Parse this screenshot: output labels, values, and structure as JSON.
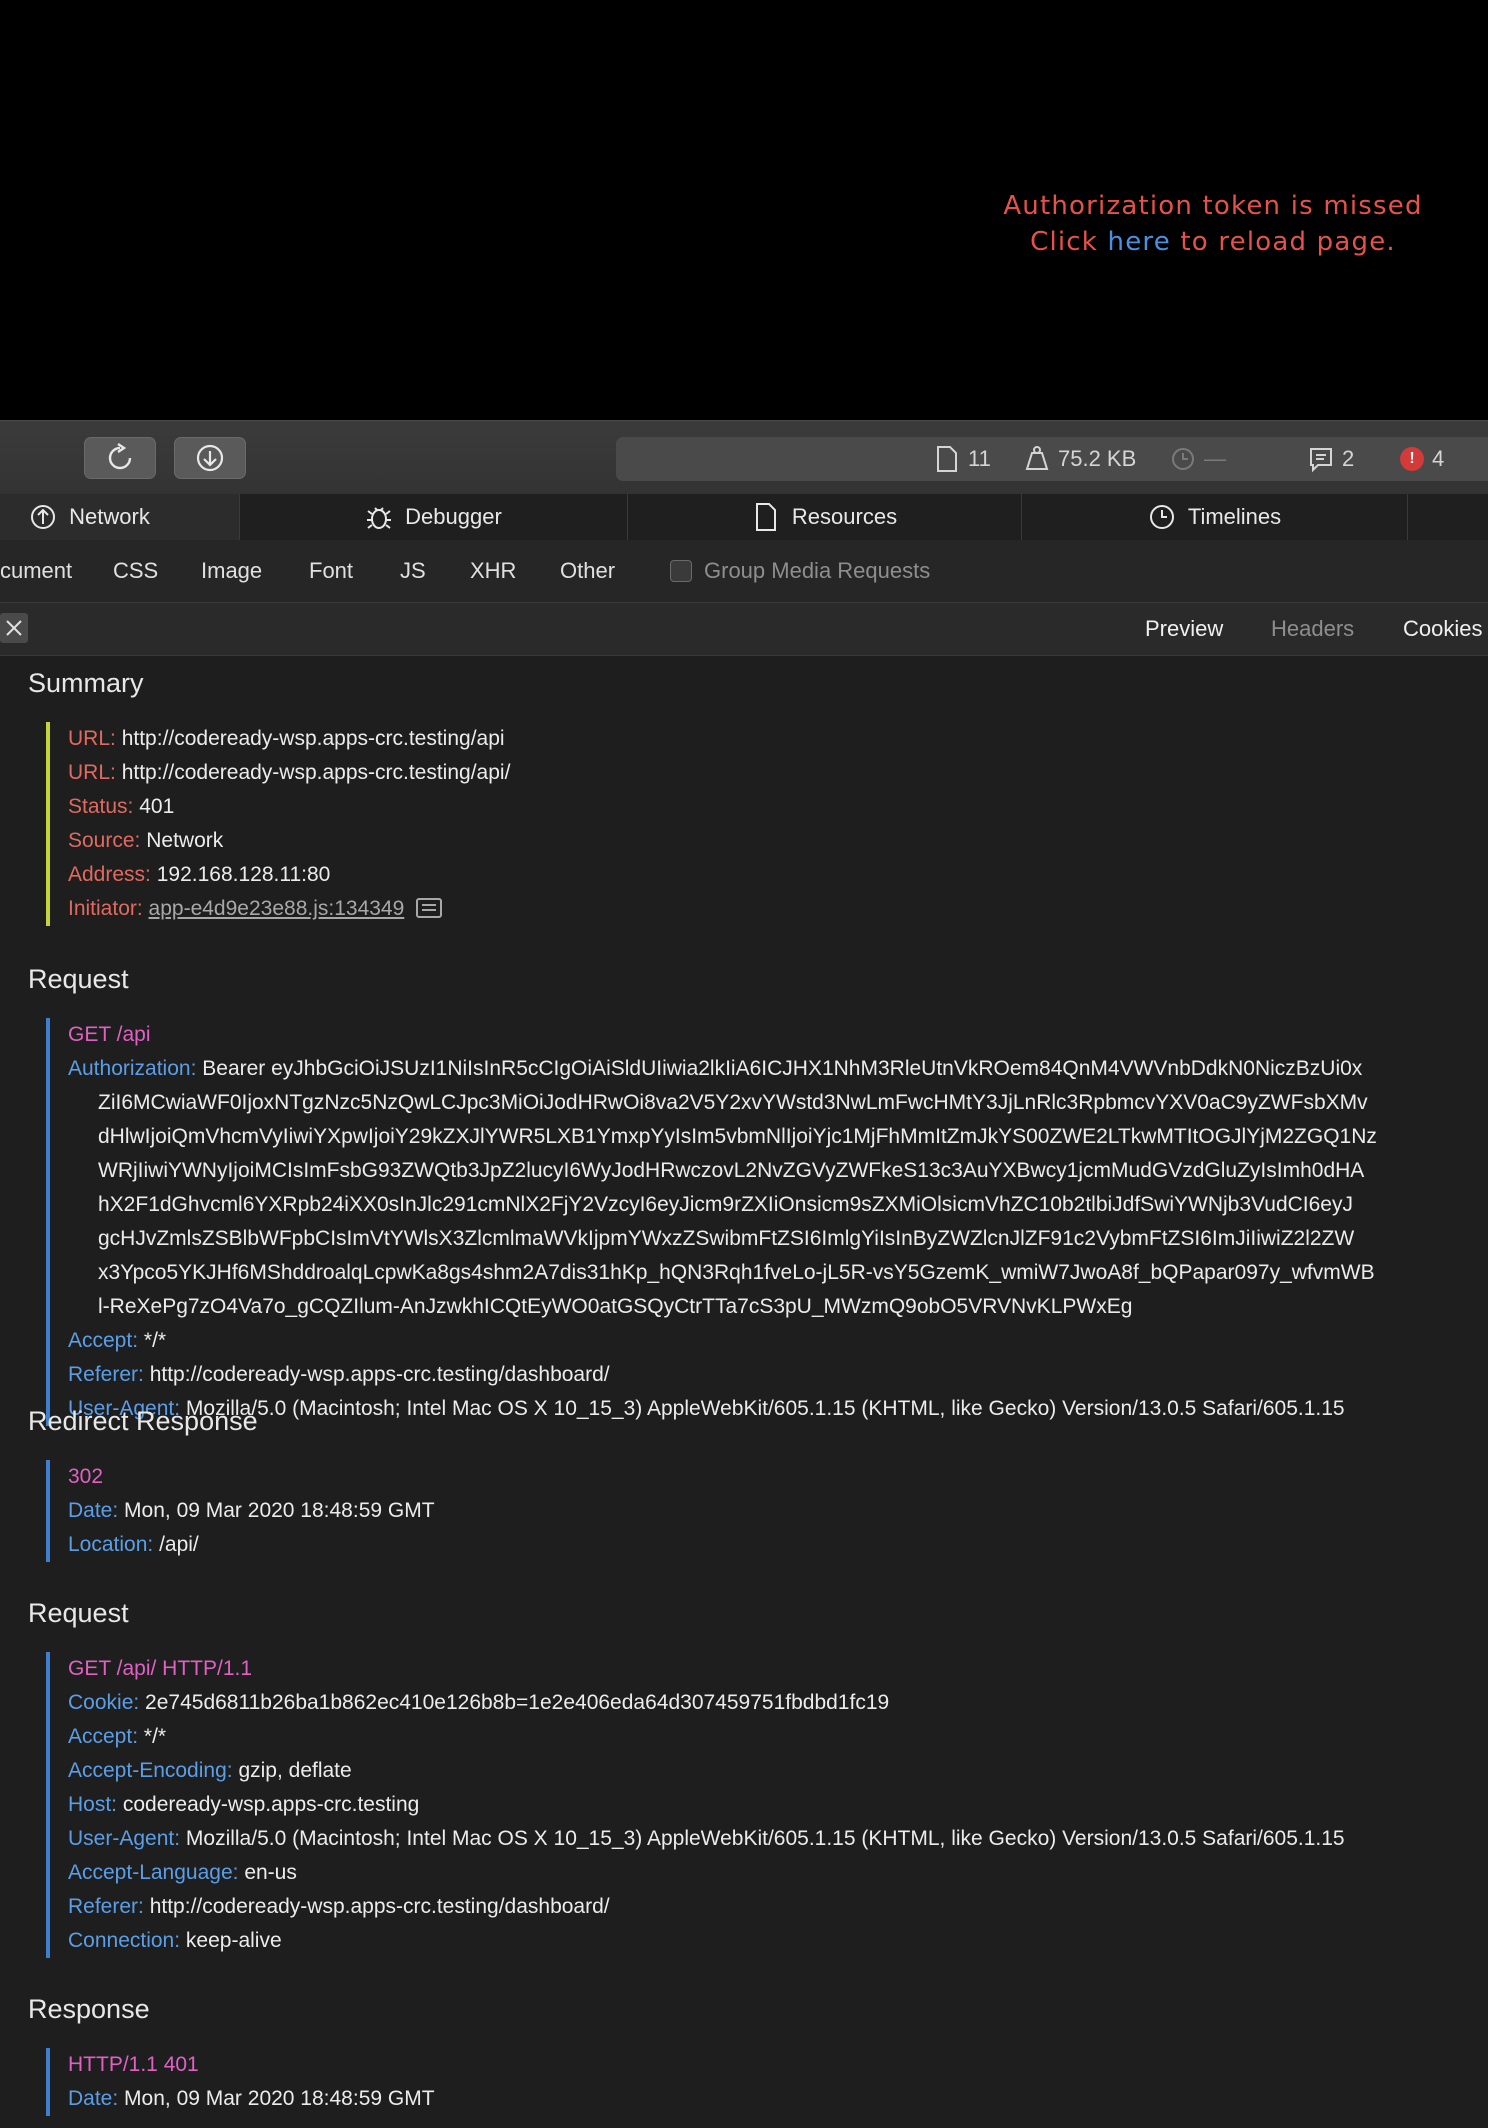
{
  "page": {
    "error_line1": "Authorization token is missed",
    "error_click": "Click ",
    "error_link": "here",
    "error_rest": " to reload page."
  },
  "toolbar": {
    "reload_icon": "reload-icon",
    "download_icon": "download-icon",
    "resources_count": "11",
    "transfer_size": "75.2 KB",
    "load_time": "—",
    "messages_count": "2",
    "errors_count": "4"
  },
  "tabs": [
    {
      "label": "Network",
      "icon": "network-icon"
    },
    {
      "label": "Debugger",
      "icon": "bug-icon"
    },
    {
      "label": "Resources",
      "icon": "document-icon"
    },
    {
      "label": "Timelines",
      "icon": "clock-icon"
    }
  ],
  "filters": [
    "cument",
    "CSS",
    "Image",
    "Font",
    "JS",
    "XHR",
    "Other"
  ],
  "group_media_label": "Group Media Requests",
  "detail_tabs": [
    "Preview",
    "Headers",
    "Cookies"
  ],
  "summary": {
    "title": "Summary",
    "rows": [
      {
        "key": "URL:",
        "value": "http://codeready-wsp.apps-crc.testing/api"
      },
      {
        "key": "URL:",
        "value": "http://codeready-wsp.apps-crc.testing/api/"
      },
      {
        "key": "Status:",
        "value": "401"
      },
      {
        "key": "Source:",
        "value": "Network"
      },
      {
        "key": "Address:",
        "value": "192.168.128.11:80"
      }
    ],
    "initiator_key": "Initiator:",
    "initiator_value": "app-e4d9e23e88.js:134349"
  },
  "request1": {
    "title": "Request",
    "line": "GET /api",
    "auth_key": "Authorization:",
    "auth_lines": [
      "Bearer eyJhbGciOiJSUzI1NiIsInR5cCIgOiAiSldUIiwia2lkIiA6ICJHX1NhM3RleUtnVkROem84QnM4VWVnbDdkN0NiczBzUi0x",
      "ZiI6MCwiaWF0IjoxNTgzNzc5NzQwLCJpc3MiOiJodHRwOi8va2V5Y2xvYWstd3NwLmFwcHMtY3JjLnRlc3RpbmcvYXV0aC9yZWFsbXMv",
      "dHlwIjoiQmVhcmVyIiwiYXpwIjoiY29kZXJlYWR5LXB1YmxpYyIsIm5vbmNlIjoiYjc1MjFhMmItZmJkYS00ZWE2LTkwMTItOGJlYjM2ZGQ1Nz",
      "WRjIiwiYWNyIjoiMCIsImFsbG93ZWQtb3JpZ2lucyI6WyJodHRwczovL2NvZGVyZWFkeS13c3AuYXBwcy1jcmMudGVzdGluZyIsImh0dHA",
      "hX2F1dGhvcml6YXRpb24iXX0sInJlc291cmNlX2FjY2VzcyI6eyJicm9rZXIiOnsicm9sZXMiOlsicmVhZC10b2tlbiJdfSwiYWNjb3VudCI6eyJ",
      "gcHJvZmlsZSBlbWFpbCIsImVtYWlsX3ZlcmlmaWVkIjpmYWxzZSwibmFtZSI6ImlgYiIsInByZWZlcnJlZF91c2VybmFtZSI6ImJiIiwiZ2l2ZW",
      "x3Ypco5YKJHf6MShddroalqLcpwKa8gs4shm2A7dis31hKp_hQN3Rqh1fveLo-jL5R-vsY5GzemK_wmiW7JwoA8f_bQPapar097y_wfvmWB",
      "l-ReXePg7zO4Va7o_gCQZIlum-AnJzwkhICQtEyWO0atGSQyCtrTTa7cS3pU_MWzmQ9obO5VRVNvKLPWxEg"
    ],
    "rows": [
      {
        "key": "Accept:",
        "value": "*/*"
      },
      {
        "key": "Referer:",
        "value": "http://codeready-wsp.apps-crc.testing/dashboard/"
      },
      {
        "key": "User-Agent:",
        "value": "Mozilla/5.0 (Macintosh; Intel Mac OS X 10_15_3) AppleWebKit/605.1.15 (KHTML, like Gecko) Version/13.0.5 Safari/605.1.15"
      }
    ]
  },
  "redirect": {
    "title": "Redirect Response",
    "line": "302",
    "rows": [
      {
        "key": "Date:",
        "value": "Mon, 09 Mar 2020 18:48:59 GMT"
      },
      {
        "key": "Location:",
        "value": "/api/"
      }
    ]
  },
  "request2": {
    "title": "Request",
    "line": "GET /api/ HTTP/1.1",
    "rows": [
      {
        "key": "Cookie:",
        "value": "2e745d6811b26ba1b862ec410e126b8b=1e2e406eda64d307459751fbdbd1fc19"
      },
      {
        "key": "Accept:",
        "value": "*/*"
      },
      {
        "key": "Accept-Encoding:",
        "value": "gzip, deflate"
      },
      {
        "key": "Host:",
        "value": "codeready-wsp.apps-crc.testing"
      },
      {
        "key": "User-Agent:",
        "value": "Mozilla/5.0 (Macintosh; Intel Mac OS X 10_15_3) AppleWebKit/605.1.15 (KHTML, like Gecko) Version/13.0.5 Safari/605.1.15"
      },
      {
        "key": "Accept-Language:",
        "value": "en-us"
      },
      {
        "key": "Referer:",
        "value": "http://codeready-wsp.apps-crc.testing/dashboard/"
      },
      {
        "key": "Connection:",
        "value": "keep-alive"
      }
    ]
  },
  "response": {
    "title": "Response",
    "line": "HTTP/1.1 401",
    "rows": [
      {
        "key": "Date:",
        "value": "Mon, 09 Mar 2020 18:48:59 GMT"
      }
    ]
  }
}
